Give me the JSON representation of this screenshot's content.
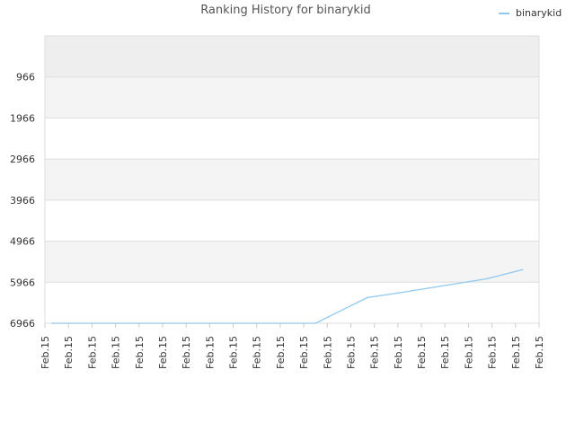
{
  "chart_data": {
    "type": "line",
    "title": "Ranking History for binarykid",
    "xlabel": "",
    "ylabel": "",
    "y_axis": {
      "reversed": true,
      "ylim": [
        -34,
        6966
      ],
      "ticks": [
        966,
        1966,
        2966,
        3966,
        4966,
        5966,
        6966
      ]
    },
    "x_tick_labels": [
      "Feb.15",
      "Feb.15",
      "Feb.15",
      "Feb.15",
      "Feb.15",
      "Feb.15",
      "Feb.15",
      "Feb.15",
      "Feb.15",
      "Feb.15",
      "Feb.15",
      "Feb.15",
      "Feb.15",
      "Feb.15",
      "Feb.15",
      "Feb.15",
      "Feb.15",
      "Feb.15",
      "Feb.15",
      "Feb.15",
      "Feb.15",
      "Feb.15"
    ],
    "grid": true,
    "legend_position": "top-right",
    "series": [
      {
        "name": "binarykid",
        "color": "#90c8f0",
        "x": [
          0.3,
          11.5,
          13.7,
          15.0,
          16.3,
          17.6,
          18.8,
          20.3
        ],
        "y": [
          6966,
          6966,
          6340,
          6230,
          6110,
          5990,
          5880,
          5660
        ]
      }
    ]
  }
}
